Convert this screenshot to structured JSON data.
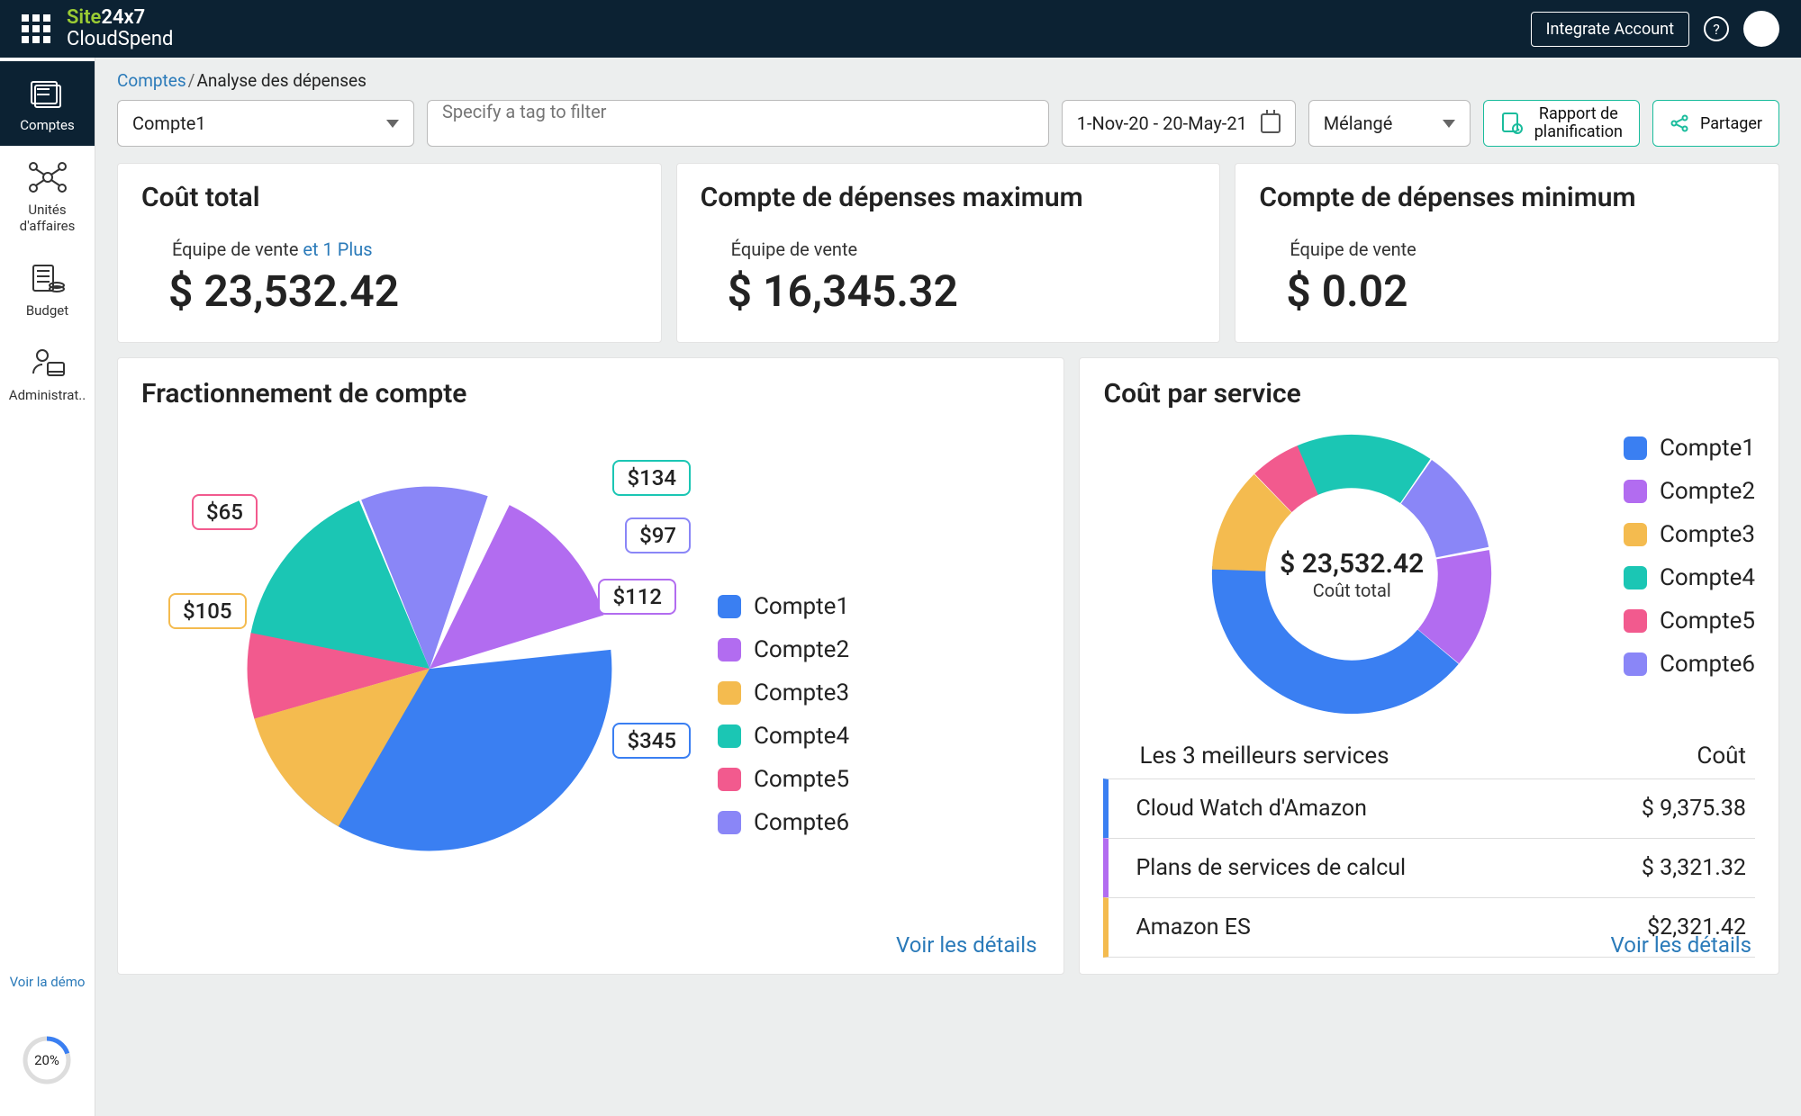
{
  "header": {
    "brand_a": "Site",
    "brand_b": "24x7",
    "brand_sub": "CloudSpend",
    "integrate": "Integrate Account",
    "help": "?"
  },
  "sidebar": {
    "items": [
      {
        "label": "Comptes"
      },
      {
        "label": "Unités d'affaires"
      },
      {
        "label": "Budget"
      },
      {
        "label": "Administrat.."
      }
    ],
    "demo": "Voir la démo",
    "progress": "20%"
  },
  "breadcrumb": {
    "root": "Comptes",
    "sep": "/",
    "page": "Analyse des dépenses"
  },
  "filters": {
    "account": "Compte1",
    "tag_placeholder": "Specify a tag to filter",
    "daterange": "1-Nov-20 - 20-May-21",
    "blend": "Mélangé",
    "report_btn_l1": "Rapport de",
    "report_btn_l2": "planification",
    "share": "Partager"
  },
  "kpis": [
    {
      "title": "Coût total",
      "sub": "Équipe de vente",
      "sub_link": "et 1 Plus",
      "value": "$ 23,532.42"
    },
    {
      "title": "Compte de dépenses maximum",
      "sub": "Équipe de vente",
      "value": "$ 16,345.32"
    },
    {
      "title": "Compte de dépenses minimum",
      "sub": "Équipe de vente",
      "value": "$ 0.02"
    }
  ],
  "split": {
    "title": "Fractionnement de compte",
    "legend": [
      "Compte1",
      "Compte2",
      "Compte3",
      "Compte4",
      "Compte5",
      "Compte6"
    ],
    "callouts": [
      "$345",
      "$112",
      "$97",
      "$134",
      "$65",
      "$105"
    ],
    "details": "Voir les détails"
  },
  "service": {
    "title": "Coût par service",
    "center_amt": "$ 23,532.42",
    "center_lbl": "Coût total",
    "legend": [
      "Compte1",
      "Compte2",
      "Compte3",
      "Compte4",
      "Compte5",
      "Compte6"
    ],
    "table_h1": "Les 3 meilleurs services",
    "table_h2": "Coût",
    "rows": [
      {
        "name": "Cloud Watch d'Amazon",
        "cost": "$ 9,375.38"
      },
      {
        "name": "Plans de services de calcul",
        "cost": "$ 3,321.32"
      },
      {
        "name": "Amazon ES",
        "cost": "$2,321.42"
      }
    ],
    "details": "Voir les détails"
  },
  "colors": [
    "#3a7ff2",
    "#b26cf0",
    "#f4bb4f",
    "#1bc6b4",
    "#f25a8e",
    "#8a86f7"
  ],
  "chart_data": [
    {
      "type": "pie",
      "title": "Fractionnement de compte",
      "categories": [
        "Compte1",
        "Compte2",
        "Compte3",
        "Compte4",
        "Compte5",
        "Compte6"
      ],
      "values": [
        345,
        112,
        105,
        134,
        65,
        97
      ],
      "value_prefix": "$"
    },
    {
      "type": "pie",
      "title": "Coût par service",
      "categories": [
        "Compte1",
        "Compte2",
        "Compte3",
        "Compte4",
        "Compte5",
        "Compte6"
      ],
      "values": [
        40,
        14,
        12,
        16,
        6,
        12
      ],
      "center_total": "$ 23,532.42",
      "note": "donut – values approximate arc percentages"
    }
  ]
}
